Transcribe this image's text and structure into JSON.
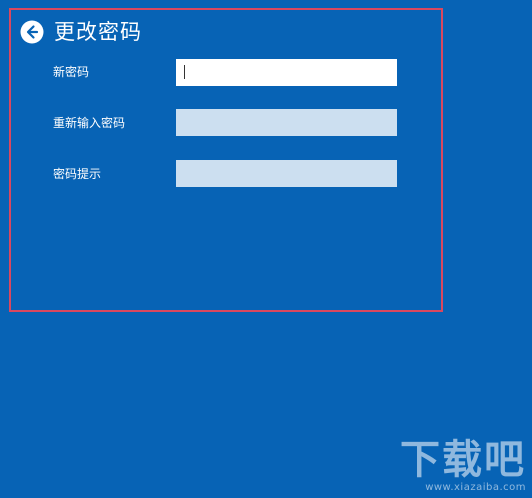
{
  "header": {
    "title": "更改密码",
    "back_icon": "arrow-left-circle-icon"
  },
  "form": {
    "new_password": {
      "label": "新密码",
      "value": ""
    },
    "confirm_password": {
      "label": "重新输入密码",
      "value": ""
    },
    "password_hint": {
      "label": "密码提示",
      "value": ""
    }
  },
  "watermark": {
    "logo": "下载吧",
    "url": "www.xiazaiba.com"
  },
  "colors": {
    "background": "#0763b5",
    "highlight_border": "#d9485f",
    "active_field": "#ffffff",
    "inactive_field": "#ccdff0"
  }
}
